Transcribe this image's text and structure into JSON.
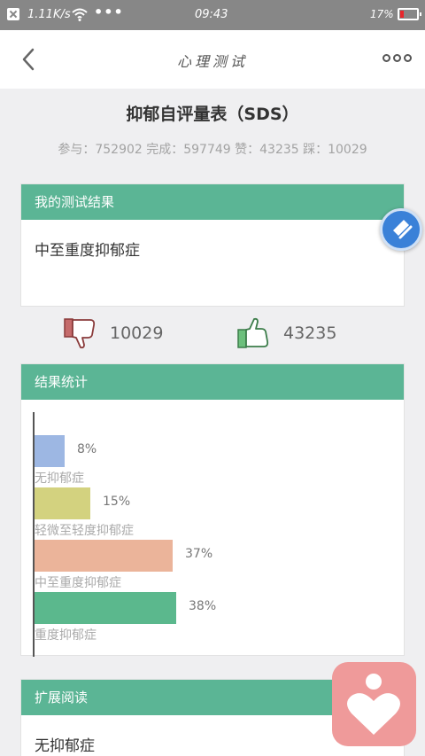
{
  "status_bar": {
    "speed": "1.11K/s",
    "more": "•••",
    "time": "09:43",
    "battery": "17%"
  },
  "nav": {
    "title": "心理测试"
  },
  "page": {
    "title": "抑郁自评量表（SDS）",
    "stats": "参与：752902 完成：597749 赞：43235 踩：10029"
  },
  "result_card": {
    "header": "我的测试结果",
    "result": "中至重度抑郁症"
  },
  "votes": {
    "dislike_count": "10029",
    "like_count": "43235"
  },
  "stats_card": {
    "header": "结果统计"
  },
  "chart_data": {
    "type": "bar",
    "orientation": "horizontal",
    "categories": [
      "无抑郁症",
      "轻微至轻度抑郁症",
      "中至重度抑郁症",
      "重度抑郁症"
    ],
    "values": [
      8,
      15,
      37,
      38
    ],
    "value_labels": [
      "8%",
      "15%",
      "37%",
      "38%"
    ],
    "colors": [
      "#9db7e3",
      "#d3d27f",
      "#ebb49a",
      "#5bb88d"
    ],
    "unit": "%"
  },
  "reading_card": {
    "header": "扩展阅读",
    "first_item": "无抑郁症"
  },
  "colors": {
    "accent": "#5bb595",
    "status_bar": "#878787",
    "share_button": "#3a81d8",
    "app_button": "#ef9a9a"
  },
  "icons": {
    "back": "chevron-left-icon",
    "more": "more-dots-icon",
    "dislike": "thumbs-down-icon",
    "like": "thumbs-up-icon",
    "share": "share-icon",
    "app": "heart-person-icon"
  }
}
